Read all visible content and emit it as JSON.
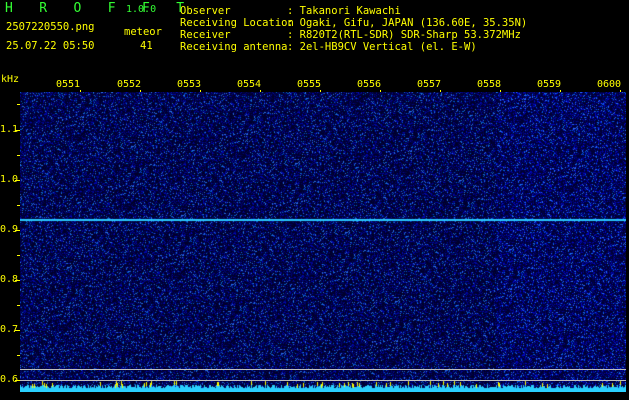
{
  "header": {
    "title": "H R O F F T",
    "version": "1.0.0",
    "filename": "2507220550.png",
    "datetime": "25.07.22 05:50",
    "meteor_label": "meteor",
    "meteor_count": "41"
  },
  "info": [
    {
      "label": "Observer",
      "value": ": Takanori Kawachi"
    },
    {
      "label": "Receiving Location",
      "value": ": Ogaki, Gifu, JAPAN (136.60E, 35.35N)"
    },
    {
      "label": "Receiver",
      "value": ": R820T2(RTL-SDR) SDR-Sharp 53.372MHz"
    },
    {
      "label": "Receiving antenna",
      "value": ": 2el-HB9CV Vertical (el. E-W)"
    }
  ],
  "axis": {
    "unit": "kHz",
    "y_ticks": [
      "1.1",
      "1.0",
      "0.9",
      "0.8",
      "0.7",
      "0.6"
    ],
    "x_ticks": [
      "0551",
      "0552",
      "0553",
      "0554",
      "0555",
      "0556",
      "0557",
      "0558",
      "0559",
      "0600"
    ]
  },
  "colors": {
    "background": "#000000",
    "noise": "#0a0a8c",
    "carrier": "#29c8ff",
    "label_yellow": "#ffff00",
    "label_green": "#33ff33",
    "level_bar": "#2ad0ff"
  }
}
